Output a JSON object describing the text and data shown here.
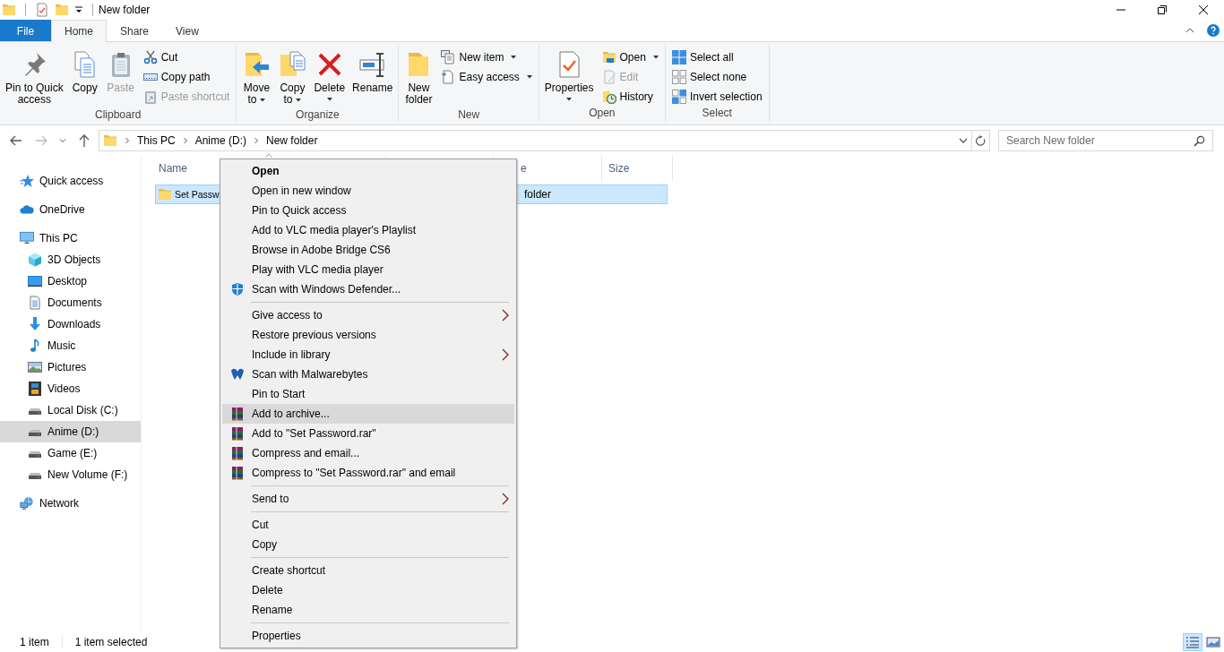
{
  "title_bar": {
    "title": "New folder"
  },
  "ribbon_tabs": [
    {
      "label": "File",
      "kind": "file",
      "selected": false
    },
    {
      "label": "Home",
      "kind": "tab",
      "selected": true
    },
    {
      "label": "Share",
      "kind": "tab",
      "selected": false
    },
    {
      "label": "View",
      "kind": "tab",
      "selected": false
    }
  ],
  "ribbon_groups": [
    {
      "label": "Clipboard",
      "items": [
        {
          "kind": "large",
          "label": "Pin to Quick access",
          "disabled": false,
          "dropdown": false
        },
        {
          "kind": "large",
          "label": "Copy",
          "disabled": false,
          "dropdown": false
        },
        {
          "kind": "large",
          "label": "Paste",
          "disabled": true,
          "dropdown": false
        },
        {
          "kind": "stack",
          "items": [
            {
              "label": "Cut",
              "disabled": false,
              "dropdown": false
            },
            {
              "label": "Copy path",
              "disabled": false,
              "dropdown": false
            },
            {
              "label": "Paste shortcut",
              "disabled": true,
              "dropdown": false
            }
          ]
        }
      ]
    },
    {
      "label": "Organize",
      "items": [
        {
          "kind": "large",
          "label": "Move to",
          "disabled": false,
          "dropdown": true
        },
        {
          "kind": "large",
          "label": "Copy to",
          "disabled": false,
          "dropdown": true
        },
        {
          "kind": "large",
          "label": "Delete",
          "disabled": false,
          "dropdown": true
        },
        {
          "kind": "large",
          "label": "Rename",
          "disabled": false,
          "dropdown": false
        }
      ]
    },
    {
      "label": "New",
      "items": [
        {
          "kind": "large",
          "label": "New folder",
          "disabled": false,
          "dropdown": false
        },
        {
          "kind": "stack",
          "items": [
            {
              "label": "New item",
              "disabled": false,
              "dropdown": true
            },
            {
              "label": "Easy access",
              "disabled": false,
              "dropdown": true
            }
          ]
        }
      ]
    },
    {
      "label": "Open",
      "items": [
        {
          "kind": "large",
          "label": "Properties",
          "disabled": false,
          "dropdown": true
        },
        {
          "kind": "stack",
          "items": [
            {
              "label": "Open",
              "disabled": false,
              "dropdown": true
            },
            {
              "label": "Edit",
              "disabled": true,
              "dropdown": false
            },
            {
              "label": "History",
              "disabled": false,
              "dropdown": false
            }
          ]
        }
      ]
    },
    {
      "label": "Select",
      "items": [
        {
          "kind": "stack",
          "items": [
            {
              "label": "Select all",
              "disabled": false,
              "dropdown": false
            },
            {
              "label": "Select none",
              "disabled": false,
              "dropdown": false
            },
            {
              "label": "Invert selection",
              "disabled": false,
              "dropdown": false
            }
          ]
        }
      ]
    }
  ],
  "address_bar": {
    "breadcrumbs": [
      "This PC",
      "Anime (D:)",
      "New folder"
    ]
  },
  "search": {
    "placeholder": "Search New folder"
  },
  "navigation_pane": {
    "items": [
      {
        "label": "Quick access",
        "selected": false
      },
      {
        "label": "OneDrive",
        "selected": false
      },
      {
        "label": "This PC",
        "selected": false,
        "children": [
          {
            "label": "3D Objects",
            "selected": false
          },
          {
            "label": "Desktop",
            "selected": false
          },
          {
            "label": "Documents",
            "selected": false
          },
          {
            "label": "Downloads",
            "selected": false
          },
          {
            "label": "Music",
            "selected": false
          },
          {
            "label": "Pictures",
            "selected": false
          },
          {
            "label": "Videos",
            "selected": false
          },
          {
            "label": "Local Disk (C:)",
            "selected": false
          },
          {
            "label": "Anime (D:)",
            "selected": true
          },
          {
            "label": "Game (E:)",
            "selected": false
          },
          {
            "label": "New Volume (F:)",
            "selected": false
          }
        ]
      },
      {
        "label": "Network",
        "selected": false
      }
    ]
  },
  "file_list": {
    "header": {
      "name": "Name",
      "type": "e",
      "size": "Size"
    },
    "rows": [
      {
        "name": "Set Passw",
        "type": "folder",
        "selected": true
      }
    ]
  },
  "context_menu": {
    "items": [
      {
        "kind": "item",
        "label": "Open",
        "default": true,
        "submenu": false,
        "selected": false
      },
      {
        "kind": "item",
        "label": "Open in new window",
        "default": false,
        "submenu": false,
        "selected": false
      },
      {
        "kind": "item",
        "label": "Pin to Quick access",
        "default": false,
        "submenu": false,
        "selected": false
      },
      {
        "kind": "item",
        "label": "Add to VLC media player's Playlist",
        "default": false,
        "submenu": false,
        "selected": false
      },
      {
        "kind": "item",
        "label": "Browse in Adobe Bridge CS6",
        "default": false,
        "submenu": false,
        "selected": false
      },
      {
        "kind": "item",
        "label": "Play with VLC media player",
        "default": false,
        "submenu": false,
        "selected": false
      },
      {
        "kind": "item",
        "label": "Scan with Windows Defender...",
        "default": false,
        "submenu": false,
        "selected": false
      },
      {
        "kind": "separator"
      },
      {
        "kind": "item",
        "label": "Give access to",
        "default": false,
        "submenu": true,
        "selected": false
      },
      {
        "kind": "item",
        "label": "Restore previous versions",
        "default": false,
        "submenu": false,
        "selected": false
      },
      {
        "kind": "item",
        "label": "Include in library",
        "default": false,
        "submenu": true,
        "selected": false
      },
      {
        "kind": "item",
        "label": "Scan with Malwarebytes",
        "default": false,
        "submenu": false,
        "selected": false
      },
      {
        "kind": "item",
        "label": "Pin to Start",
        "default": false,
        "submenu": false,
        "selected": false
      },
      {
        "kind": "item",
        "label": "Add to archive...",
        "default": false,
        "submenu": false,
        "selected": true
      },
      {
        "kind": "item",
        "label": "Add to \"Set Password.rar\"",
        "default": false,
        "submenu": false,
        "selected": false
      },
      {
        "kind": "item",
        "label": "Compress and email...",
        "default": false,
        "submenu": false,
        "selected": false
      },
      {
        "kind": "item",
        "label": "Compress to \"Set Password.rar\" and email",
        "default": false,
        "submenu": false,
        "selected": false
      },
      {
        "kind": "separator"
      },
      {
        "kind": "item",
        "label": "Send to",
        "default": false,
        "submenu": true,
        "selected": false
      },
      {
        "kind": "separator"
      },
      {
        "kind": "item",
        "label": "Cut",
        "default": false,
        "submenu": false,
        "selected": false
      },
      {
        "kind": "item",
        "label": "Copy",
        "default": false,
        "submenu": false,
        "selected": false
      },
      {
        "kind": "separator"
      },
      {
        "kind": "item",
        "label": "Create shortcut",
        "default": false,
        "submenu": false,
        "selected": false
      },
      {
        "kind": "item",
        "label": "Delete",
        "default": false,
        "submenu": false,
        "selected": false
      },
      {
        "kind": "item",
        "label": "Rename",
        "default": false,
        "submenu": false,
        "selected": false
      },
      {
        "kind": "separator"
      },
      {
        "kind": "item",
        "label": "Properties",
        "default": false,
        "submenu": false,
        "selected": false
      }
    ]
  },
  "status_bar": {
    "texts": [
      "1 item",
      "1 item selected"
    ],
    "view_buttons": [
      {
        "selected": true
      },
      {
        "selected": false
      }
    ]
  }
}
